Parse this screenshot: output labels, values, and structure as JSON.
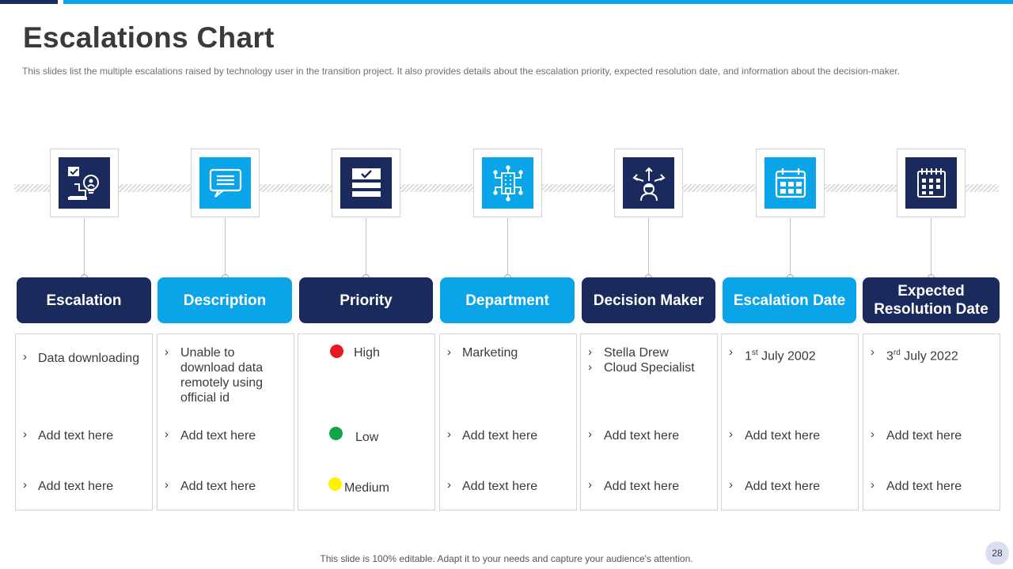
{
  "slide": {
    "title": "Escalations Chart",
    "subtitle": "This slides list the multiple escalations raised by technology user in the transition project. It also provides  details about the escalation priority, expected resolution date, and information about the decision-maker.",
    "footer": "This slide is 100% editable. Adapt it to your needs and capture your audience's attention.",
    "page_number": "28"
  },
  "colors": {
    "dark": "#1b2a5c",
    "light": "#0aa5e8",
    "high": "#e8191f",
    "low": "#13a54a",
    "medium": "#fff200"
  },
  "columns": [
    {
      "id": "escalation",
      "label": "Escalation",
      "icon": "escalation-person-icon",
      "items": [
        "Data downloading",
        "Add text here",
        "Add text here"
      ]
    },
    {
      "id": "description",
      "label": "Description",
      "icon": "message-screen-icon",
      "items": [
        "Unable to download data remotely using official id",
        "Add text here",
        "Add text here"
      ]
    },
    {
      "id": "priority",
      "label": "Priority",
      "icon": "checklist-icon",
      "items": [
        "High",
        "Low",
        "Medium"
      ]
    },
    {
      "id": "department",
      "label": "Department",
      "icon": "building-network-icon",
      "items": [
        "Marketing",
        "Add text here",
        "Add text here"
      ]
    },
    {
      "id": "decision-maker",
      "label": "Decision Maker",
      "icon": "decision-arrows-person-icon",
      "items": [
        "Stella Drew",
        "Cloud Specialist",
        "Add text here",
        "Add text here"
      ]
    },
    {
      "id": "escalation-date",
      "label": "Escalation Date",
      "icon": "calendar-icon",
      "items": [
        {
          "pre": "1",
          "sup": "st",
          "post": " July 2002"
        },
        "Add text here",
        "Add text here"
      ]
    },
    {
      "id": "expected-resolution-date",
      "label": "Expected Resolution Date",
      "icon": "spiral-calendar-icon",
      "items": [
        {
          "pre": "3",
          "sup": "rd",
          "post": " July 2022"
        },
        "Add text here",
        "Add text here"
      ]
    }
  ]
}
